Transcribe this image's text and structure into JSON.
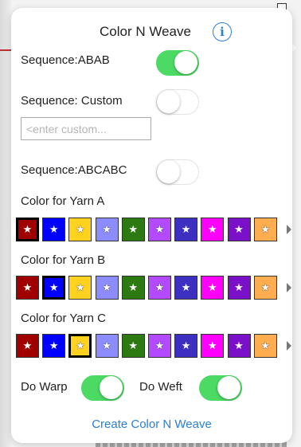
{
  "popover": {
    "title": "Color N Weave",
    "info_label": "i"
  },
  "sequences": {
    "abab": {
      "label": "Sequence:ABAB",
      "on": true
    },
    "custom": {
      "label": "Sequence: Custom",
      "on": false,
      "input_placeholder": "<enter custom...",
      "input_value": ""
    },
    "abcabc": {
      "label": "Sequence:ABCABC",
      "on": false
    }
  },
  "colors": {
    "palette": [
      "#a00000",
      "#0000ff",
      "#ffd21f",
      "#8c8cff",
      "#2d7a12",
      "#b44aff",
      "#3d2fc0",
      "#ff00ff",
      "#7a10c8",
      "#ffad4f"
    ],
    "star_glyph": "★",
    "yarn_a": {
      "label": "Color for Yarn A",
      "selected_index": 0
    },
    "yarn_b": {
      "label": "Color for Yarn B",
      "selected_index": 1
    },
    "yarn_c": {
      "label": "Color for Yarn C",
      "selected_index": 2
    }
  },
  "options": {
    "warp": {
      "label": "Do Warp",
      "on": true
    },
    "weft": {
      "label": "Do Weft",
      "on": true
    }
  },
  "actions": {
    "create_label": "Create Color N Weave"
  },
  "theme": {
    "accent": "#2a7fd6",
    "toggle_on": "#4cd964"
  }
}
